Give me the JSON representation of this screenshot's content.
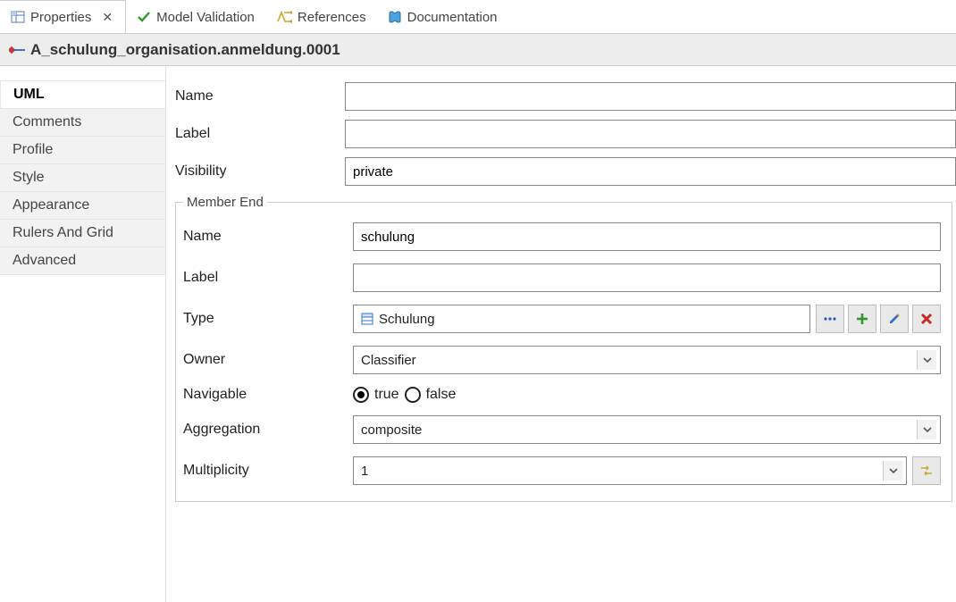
{
  "tabs": {
    "properties": {
      "label": "Properties"
    },
    "model_validation": {
      "label": "Model Validation"
    },
    "references": {
      "label": "References"
    },
    "documentation": {
      "label": "Documentation"
    }
  },
  "title": "A_schulung_organisation.anmeldung.0001",
  "sidebar": {
    "items": [
      {
        "id": "uml",
        "label": "UML",
        "selected": true
      },
      {
        "id": "comments",
        "label": "Comments"
      },
      {
        "id": "profile",
        "label": "Profile"
      },
      {
        "id": "style",
        "label": "Style"
      },
      {
        "id": "appearance",
        "label": "Appearance"
      },
      {
        "id": "rulers",
        "label": "Rulers And Grid"
      },
      {
        "id": "advanced",
        "label": "Advanced"
      }
    ]
  },
  "form": {
    "name_label": "Name",
    "name_value": "",
    "label_label": "Label",
    "label_value": "",
    "visibility_label": "Visibility",
    "visibility_value": "private"
  },
  "member_end": {
    "legend": "Member End",
    "name_label": "Name",
    "name_value": "schulung",
    "label_label": "Label",
    "label_value": "",
    "type_label": "Type",
    "type_value": "Schulung",
    "owner_label": "Owner",
    "owner_value": "Classifier",
    "navigable_label": "Navigable",
    "navigable_true": "true",
    "navigable_false": "false",
    "navigable_selected": "true",
    "aggregation_label": "Aggregation",
    "aggregation_value": "composite",
    "multiplicity_label": "Multiplicity",
    "multiplicity_value": "1"
  }
}
